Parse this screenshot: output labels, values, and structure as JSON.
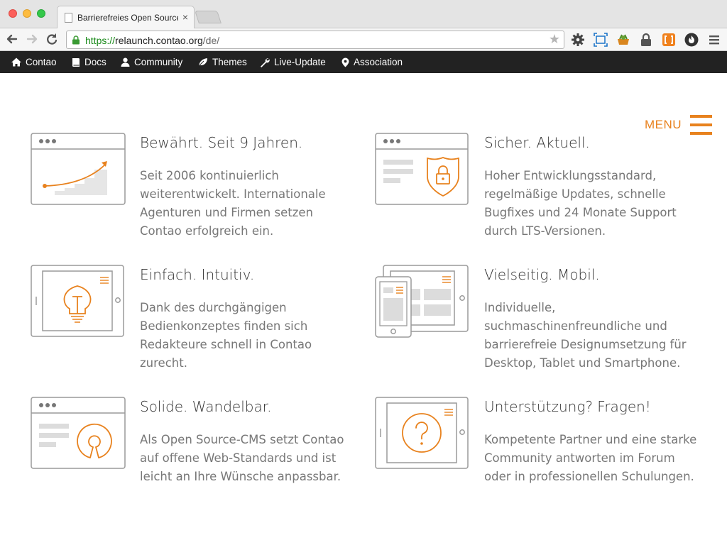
{
  "browser": {
    "tab_title": "Barrierefreies Open Source",
    "tab_close": "×",
    "url_scheme": "https://",
    "url_host": "relaunch.contao.org",
    "url_path": "/de/"
  },
  "site_nav": {
    "items": [
      {
        "label": "Contao",
        "icon": "home-icon"
      },
      {
        "label": "Docs",
        "icon": "book-icon"
      },
      {
        "label": "Community",
        "icon": "user-icon"
      },
      {
        "label": "Themes",
        "icon": "leaf-icon"
      },
      {
        "label": "Live-Update",
        "icon": "wrench-icon"
      },
      {
        "label": "Association",
        "icon": "map-pin-icon"
      }
    ]
  },
  "menu": {
    "label": "MENU"
  },
  "colors": {
    "accent": "#e8821e",
    "nav_bg": "#222222",
    "text": "#333333",
    "muted": "#777777",
    "line": "#999999"
  },
  "features": [
    {
      "heading": "Bewährt. Seit 9 Jahren.",
      "lines": [
        "Seit 2006 kontinuierlich",
        "weiterentwickelt. Internationale",
        "Agenturen und Firmen setzen",
        "Contao erfolgreich ein."
      ],
      "icon": "growth-chart-icon"
    },
    {
      "heading": "Sicher. Aktuell.",
      "lines": [
        "Hoher Entwicklungsstandard,",
        "regelmäßige Updates, schnelle",
        "Bugfixes und 24 Monate Support",
        "durch LTS-Versionen."
      ],
      "icon": "shield-lock-icon"
    },
    {
      "heading": "Einfach. Intuitiv.",
      "lines": [
        "Dank des durchgängigen",
        "Bedienkonzeptes finden sich",
        "Redakteure schnell in Contao",
        "zurecht."
      ],
      "icon": "lightbulb-icon"
    },
    {
      "heading": "Vielseitig. Mobil.",
      "lines": [
        "Individuelle,",
        "suchmaschinenfreundliche und",
        "barrierefreie Designumsetzung für",
        "Desktop, Tablet und Smartphone."
      ],
      "icon": "devices-icon"
    },
    {
      "heading": "Solide. Wandelbar.",
      "lines": [
        "Als Open Source-CMS setzt Contao",
        "auf offene Web-Standards und ist",
        "leicht an Ihre Wünsche anpassbar."
      ],
      "icon": "open-source-icon"
    },
    {
      "heading": "Unterstützung? Fragen!",
      "lines": [
        "Kompetente Partner und eine starke",
        "Community antworten im Forum",
        "oder in professionellen Schulungen."
      ],
      "icon": "question-icon"
    }
  ]
}
